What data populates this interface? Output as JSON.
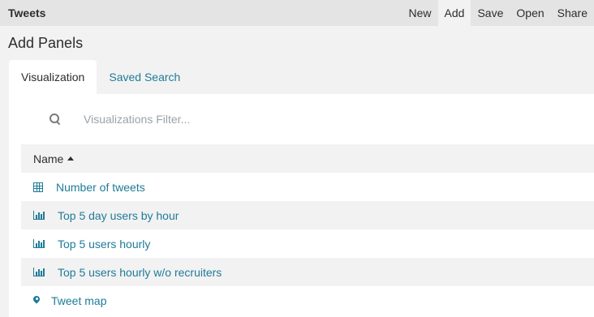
{
  "app": {
    "title": "Tweets"
  },
  "menu": [
    {
      "label": "New"
    },
    {
      "label": "Add",
      "active": true
    },
    {
      "label": "Save"
    },
    {
      "label": "Open"
    },
    {
      "label": "Share"
    }
  ],
  "panel": {
    "title": "Add Panels"
  },
  "tabs": [
    {
      "label": "Visualization",
      "active": true
    },
    {
      "label": "Saved Search",
      "active": false
    }
  ],
  "search": {
    "placeholder": "Visualizations Filter...",
    "value": ""
  },
  "list": {
    "header": "Name",
    "sort": "ascending",
    "items": [
      {
        "label": "Number of tweets",
        "icon": "table-icon"
      },
      {
        "label": "Top 5 day users by hour",
        "icon": "bar-chart-icon"
      },
      {
        "label": "Top 5 users hourly",
        "icon": "bar-chart-icon"
      },
      {
        "label": "Top 5 users hourly w/o recruiters",
        "icon": "bar-chart-icon"
      },
      {
        "label": "Tweet map",
        "icon": "map-marker-icon"
      }
    ]
  },
  "colors": {
    "link": "#1f7b98",
    "topbar": "#e4e4e4",
    "background": "#f2f2f2"
  }
}
